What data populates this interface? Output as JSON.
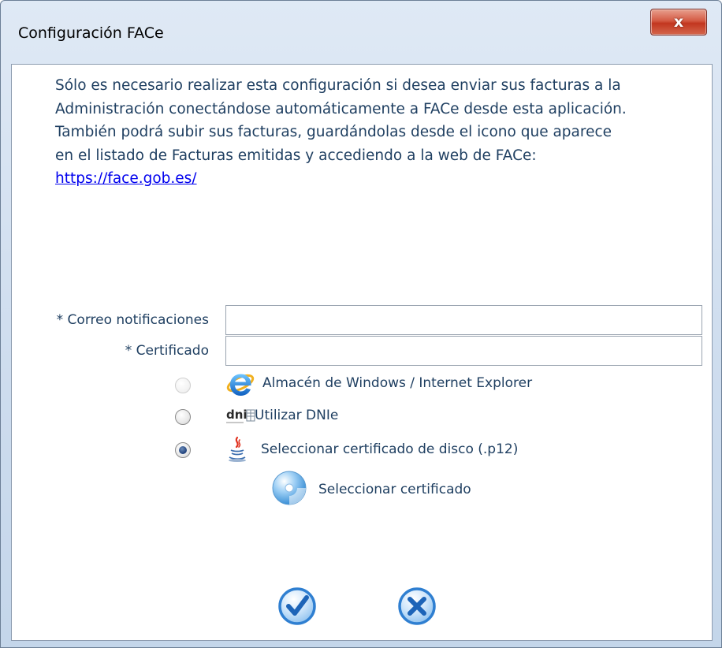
{
  "window": {
    "title": "Configuración FACe",
    "close_label": "x"
  },
  "intro": {
    "lines": [
      "Sólo es necesario realizar esta configuración si desea enviar sus facturas a la",
      "Administración conectándose automáticamente a FACe desde esta aplicación.",
      "También podrá subir sus facturas, guardándolas desde el icono que aparece",
      "en el listado de Facturas emitidas y accediendo a la web de FACe:"
    ],
    "link": "https://face.gob.es/"
  },
  "form": {
    "email": {
      "label": "* Correo notificaciones",
      "value": "",
      "placeholder": ""
    },
    "certificate": {
      "label": "* Certificado",
      "value": "",
      "placeholder": ""
    }
  },
  "options": [
    {
      "label": "Almacén de Windows / Internet Explorer",
      "icon": "internet-explorer-icon",
      "state": "disabled"
    },
    {
      "label": "Utilizar DNIe",
      "icon": "dni-icon",
      "state": "unchecked"
    },
    {
      "label": "Seleccionar certificado de disco (.p12)",
      "icon": "java-icon",
      "state": "checked"
    }
  ],
  "select_certificate": {
    "label": "Seleccionar certificado",
    "icon": "disc-icon"
  },
  "actions": {
    "accept_icon": "check-icon",
    "cancel_icon": "cancel-x-icon"
  },
  "colors": {
    "text": "#1f3f61",
    "link": "#0000ee",
    "accent_blue": "#2f7fd1",
    "close_red": "#c2361f"
  }
}
